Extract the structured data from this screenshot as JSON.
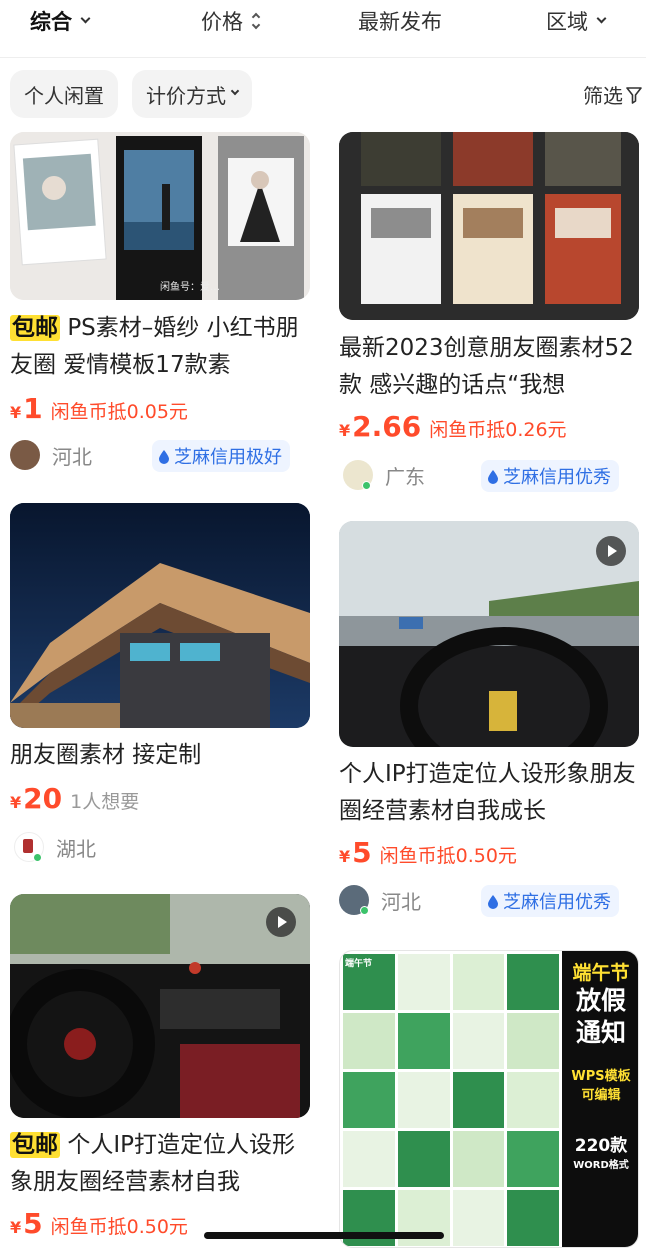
{
  "sort_bar": {
    "items": [
      {
        "label": "综合",
        "active": true
      },
      {
        "label": "价格",
        "active": false
      },
      {
        "label": "最新发布",
        "active": false
      },
      {
        "label": "区域",
        "active": false
      }
    ]
  },
  "filters": {
    "chips": [
      "个人闲置",
      "计价方式"
    ],
    "filter_label": "筛选"
  },
  "colors": {
    "price": "#ff4b2b",
    "free_shipping_tag": "#ffe033",
    "credit_badge_bg": "#eef4ff",
    "credit_badge_text": "#2f6fe4"
  },
  "listings": [
    {
      "tag": "包邮",
      "title": "PS素材–婚纱 小红书朋友圈 爱情模板17款素",
      "currency": "¥",
      "price": "1",
      "price_note": "闲鱼币抵0.05元",
      "location": "河北",
      "credit": "芝麻信用极好",
      "image_caption": "闲鱼号：爱…"
    },
    {
      "title": "最新2023创意朋友圈素材52款 感兴趣的话点“我想",
      "currency": "¥",
      "price": "2.66",
      "price_note": "闲鱼币抵0.26元",
      "location": "广东",
      "credit": "芝麻信用优秀"
    },
    {
      "title": "朋友圈素材 接定制",
      "currency": "¥",
      "price": "20",
      "price_note": "1人想要",
      "location": "湖北"
    },
    {
      "title": "个人IP打造定位人设形象朋友圈经营素材自我成长",
      "currency": "¥",
      "price": "5",
      "price_note": "闲鱼币抵0.50元",
      "location": "河北",
      "credit": "芝麻信用优秀",
      "video": true
    },
    {
      "tag": "包邮",
      "title": "个人IP打造定位人设形象朋友圈经营素材自我",
      "currency": "¥",
      "price": "5",
      "price_note": "闲鱼币抵0.50元",
      "video": true
    },
    {
      "poster": {
        "title_lines": [
          "端午节",
          "放假",
          "通知"
        ],
        "sub1": "WPS模板",
        "sub2": "可编辑",
        "count": "220款",
        "format": "WORD格式",
        "thumb_label": "端午节"
      }
    }
  ]
}
